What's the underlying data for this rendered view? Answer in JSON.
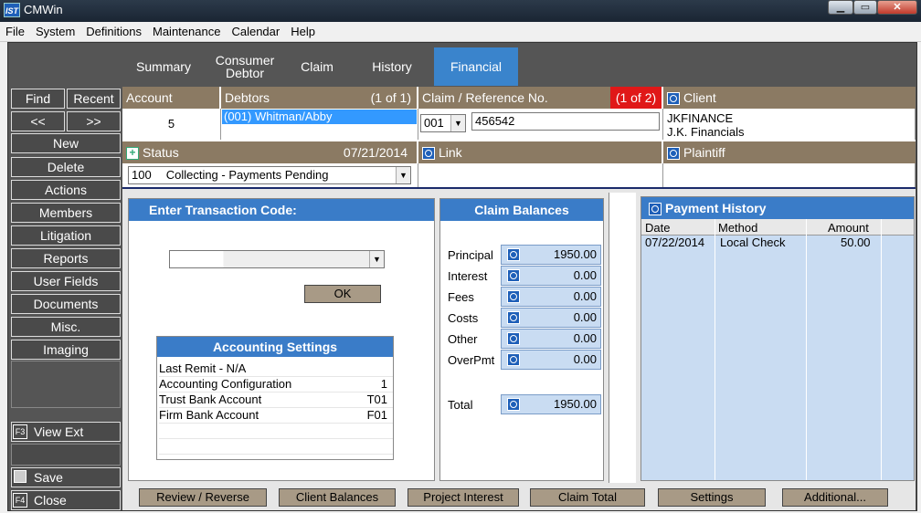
{
  "window": {
    "title": "CMWin",
    "app_icon_text": "IST",
    "min": "▁",
    "max": "▭",
    "close": "✕"
  },
  "menu": [
    "File",
    "System",
    "Definitions",
    "Maintenance",
    "Calendar",
    "Help"
  ],
  "tabs": [
    {
      "label": "Summary"
    },
    {
      "label": "Consumer Debtor"
    },
    {
      "label": "Claim"
    },
    {
      "label": "History"
    },
    {
      "label": "Financial"
    }
  ],
  "nav": {
    "find": "Find",
    "recent": "Recent",
    "prev": "<<",
    "next": ">>",
    "items": [
      "New",
      "Delete",
      "Actions",
      "Members",
      "Litigation",
      "Reports",
      "User Fields",
      "Documents",
      "Misc.",
      "Imaging"
    ],
    "view_ext": "View Ext",
    "save": "Save",
    "close": "Close",
    "f3": "F3",
    "f4": "F4"
  },
  "account": {
    "label": "Account",
    "value": "5"
  },
  "debtors": {
    "label": "Debtors",
    "count": "(1 of 1)",
    "selected": "(001) Whitman/Abby"
  },
  "claim": {
    "label": "Claim / Reference No.",
    "count": "(1 of 2)",
    "num": "001",
    "ref": "456542"
  },
  "client": {
    "label": "Client",
    "code": "JKFINANCE",
    "name": "J.K. Financials"
  },
  "status": {
    "label": "Status",
    "date": "07/21/2014",
    "code": "100",
    "text": "Collecting - Payments Pending"
  },
  "link": {
    "label": "Link"
  },
  "plaintiff": {
    "label": "Plaintiff"
  },
  "transaction": {
    "title": "Enter Transaction Code:",
    "ok": "OK"
  },
  "accounting": {
    "title": "Accounting Settings",
    "rows": [
      {
        "label": "Last Remit - N/A",
        "value": ""
      },
      {
        "label": "Accounting Configuration",
        "value": "1"
      },
      {
        "label": "Trust Bank Account",
        "value": "T01"
      },
      {
        "label": "Firm Bank Account",
        "value": "F01"
      }
    ]
  },
  "balances": {
    "title": "Claim Balances",
    "rows": [
      {
        "label": "Principal",
        "value": "1950.00"
      },
      {
        "label": "Interest",
        "value": "0.00"
      },
      {
        "label": "Fees",
        "value": "0.00"
      },
      {
        "label": "Costs",
        "value": "0.00"
      },
      {
        "label": "Other",
        "value": "0.00"
      },
      {
        "label": "OverPmt",
        "value": "0.00"
      }
    ],
    "total_label": "Total",
    "total": "1950.00"
  },
  "payments": {
    "title": "Payment History",
    "headers": [
      "Date",
      "Method",
      "Amount"
    ],
    "rows": [
      {
        "date": "07/22/2014",
        "method": "Local Check",
        "amount": "50.00"
      }
    ]
  },
  "bottom": [
    "Review / Reverse",
    "Client Balances",
    "Project Interest",
    "Claim Total",
    "Settings",
    "Additional..."
  ]
}
